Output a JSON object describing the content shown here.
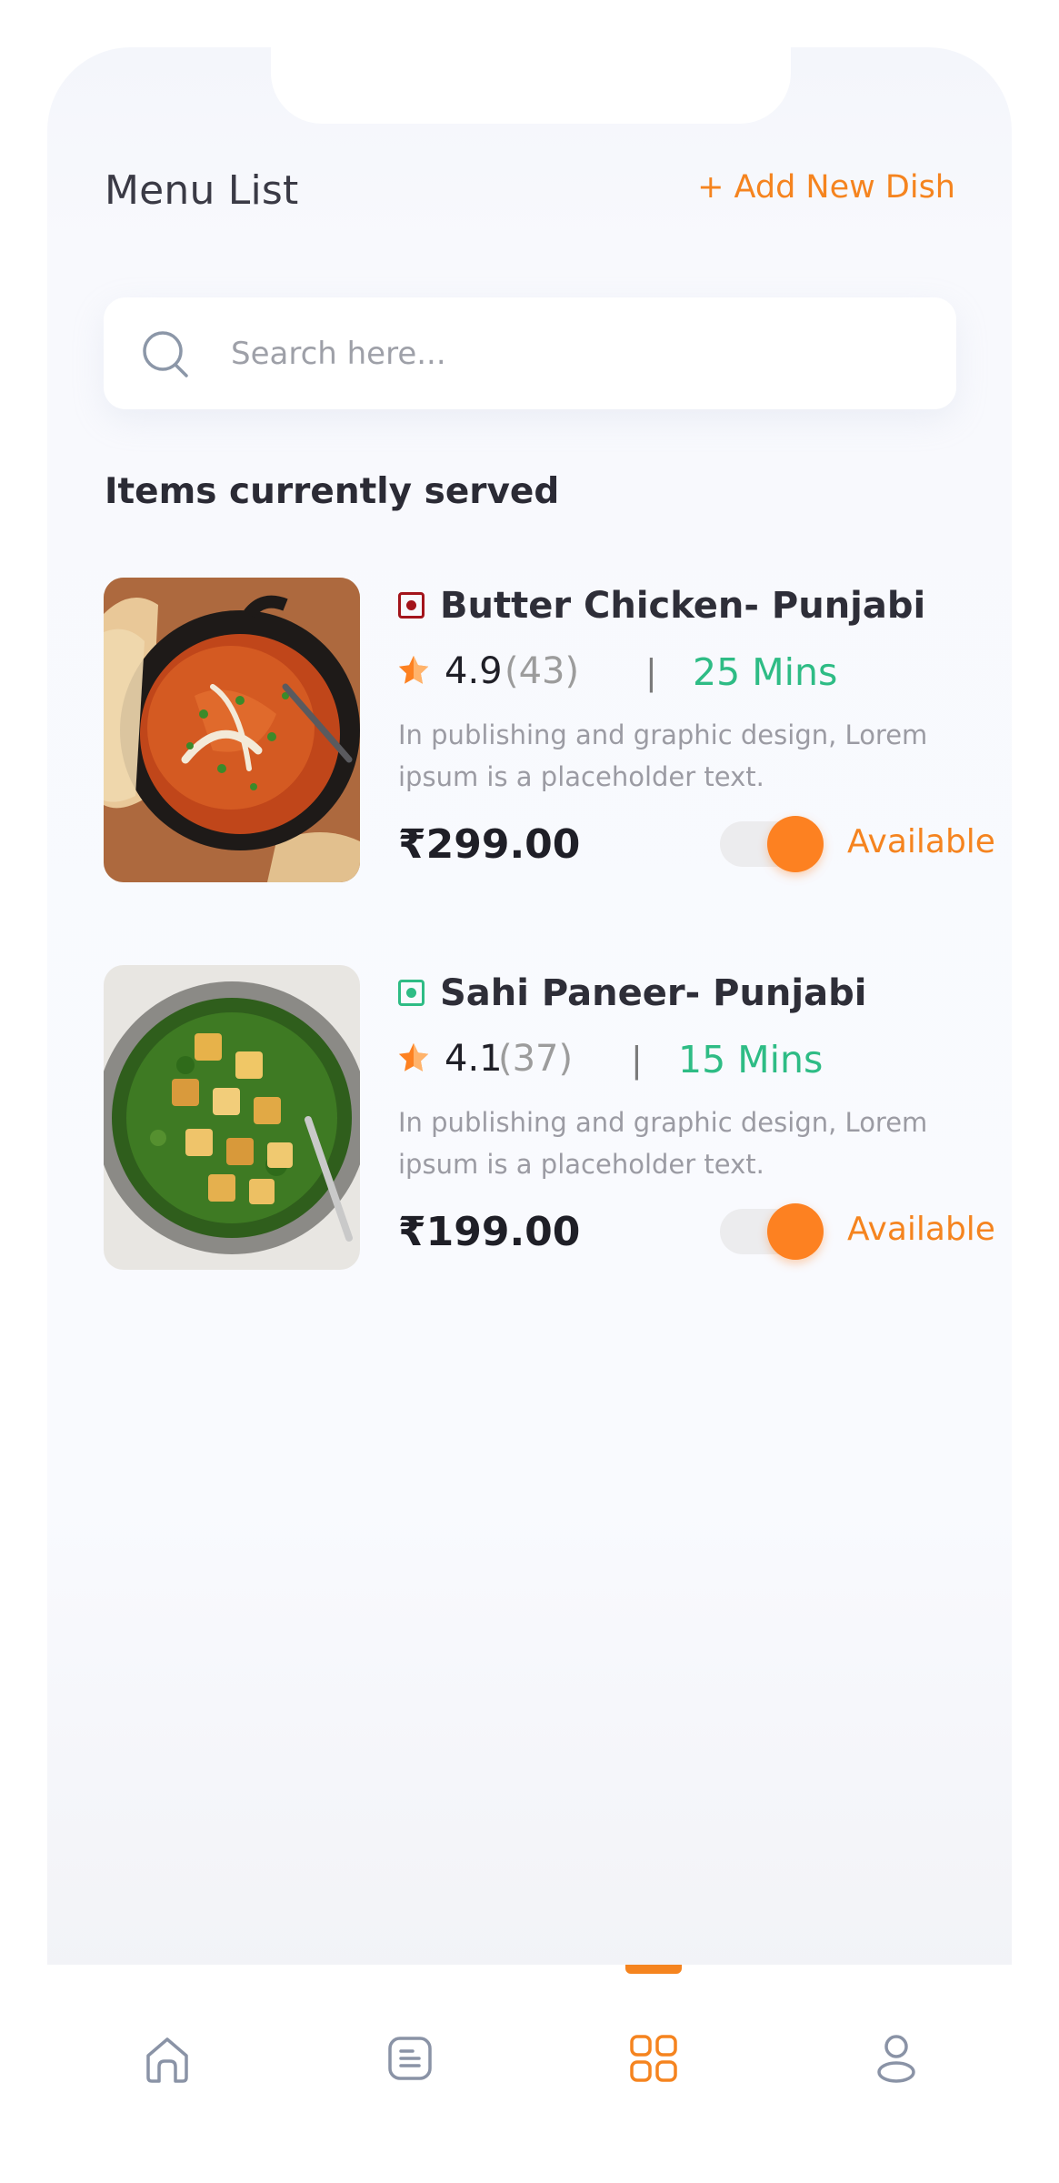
{
  "header": {
    "title": "Menu List",
    "add_label": "+ Add New Dish"
  },
  "search": {
    "placeholder": "Search here...",
    "icon": "search-icon"
  },
  "section_title": "Items currently served",
  "dishes": [
    {
      "name": "Butter Chicken- Punjabi",
      "diet": "non-veg",
      "rating": "4.9",
      "rating_count": "(43)",
      "separator": "|",
      "time": "25 Mins",
      "description": "In publishing and graphic design, Lorem ipsum is a placeholder text.",
      "price": "₹299.00",
      "available": true,
      "status_label": "Available"
    },
    {
      "name": "Sahi Paneer- Punjabi",
      "diet": "veg",
      "rating": "4.1",
      "rating_count": "(37)",
      "separator": "|",
      "time": "15 Mins",
      "description": "In publishing and graphic design, Lorem ipsum is a placeholder text.",
      "price": "₹199.00",
      "available": true,
      "status_label": "Available"
    }
  ],
  "nav": {
    "items": [
      {
        "icon": "home-icon",
        "active": false
      },
      {
        "icon": "orders-icon",
        "active": false
      },
      {
        "icon": "menu-grid-icon",
        "active": true
      },
      {
        "icon": "profile-icon",
        "active": false
      }
    ]
  },
  "colors": {
    "accent": "#f5841f",
    "green": "#2ebc85",
    "non_veg": "#a3141b",
    "veg": "#2ebc85",
    "inactive_icon": "#8a93a6"
  }
}
